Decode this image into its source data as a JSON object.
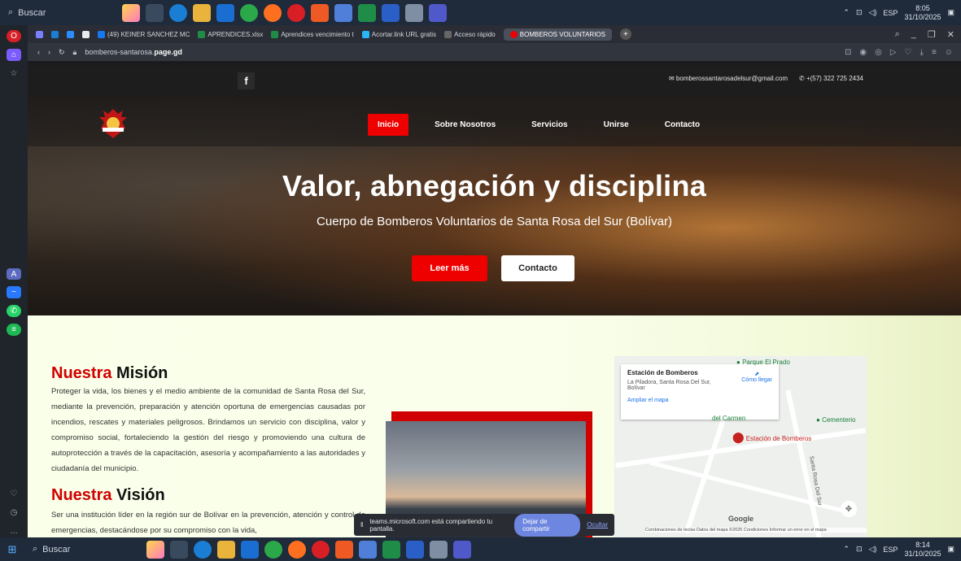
{
  "os": {
    "search_label": "Buscar",
    "tray_lang": "ESP",
    "top_time": "8:05",
    "top_date": "31/10/2025",
    "bottom_time": "8:14",
    "bottom_date": "31/10/2025"
  },
  "tabs": [
    {
      "label": "(49) KEINER SANCHEZ MC"
    },
    {
      "label": "APRENDICES.xlsx"
    },
    {
      "label": "Aprendices vencimiento t"
    },
    {
      "label": "Acortar.link URL gratis"
    },
    {
      "label": "Acceso rápido"
    },
    {
      "label": "BOMBEROS VOLUNTARIOS"
    }
  ],
  "address": {
    "prefix": "bomberos-santarosa.",
    "domain": "page.gd"
  },
  "site": {
    "fb_label": "f",
    "email": "bomberossantarosadelsur@gmail.com",
    "phone": "+(57) 322 725 2434",
    "nav": [
      "Inicio",
      "Sobre Nosotros",
      "Servicios",
      "Unirse",
      "Contacto"
    ],
    "hero_title": "Valor, abnegación y disciplina",
    "hero_subtitle": "Cuerpo de Bomberos Voluntarios de Santa Rosa del Sur (Bolívar)",
    "btn_primary": "Leer más",
    "btn_secondary": "Contacto",
    "mision_title_red": "Nuestra",
    "mision_title_black": "Misión",
    "mision_text": "Proteger la vida, los bienes y el medio ambiente de la comunidad de Santa Rosa del Sur, mediante la prevención, preparación y atención oportuna de emergencias causadas por incendios, rescates y materiales peligrosos. Brindamos un servicio con disciplina, valor y compromiso social, fortaleciendo la gestión del riesgo y promoviendo una cultura de autoprotección a través de la capacitación, asesoría y acompañamiento a las autoridades y ciudadanía del municipio.",
    "vision_title_red": "Nuestra",
    "vision_title_black": "Visión",
    "vision_text": "Ser una institución líder en la región sur de Bolívar en la prevención, atención y control de emergencias, destacándose por su compromiso con la vida,"
  },
  "map": {
    "place": "Estación de Bomberos",
    "address": "La Piladora, Santa Rosa Del Sur, Bolívar",
    "directions": "Cómo llegar",
    "enlarge": "Ampliar el mapa",
    "pin_label": "Estación de Bomberos",
    "poi_1": "Parque El Prado",
    "poi_2": "Cementerio",
    "poi_3": "del Carmen",
    "street": "Santa Rosa Del Sur",
    "google": "Google",
    "footer": "Combinaciones de teclas   Datos del mapa ©2025   Condiciones   Informar un error en el mapa"
  },
  "teams": {
    "message": "teams.microsoft.com está compartiendo tu pantalla.",
    "stop": "Dejar de compartir",
    "hide": "Ocultar"
  },
  "colors": {
    "accent_red": "#e00000",
    "taskbar": "#1f2a3a",
    "teams_button": "#6d86e0"
  }
}
